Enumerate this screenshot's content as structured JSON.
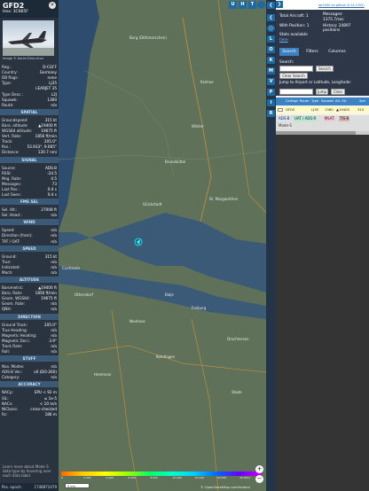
{
  "aircraft": {
    "callsign": "GFD2",
    "hex_line": "Hex: 3C665F",
    "photo_credit": "Image © Aaron Eden-Aruz"
  },
  "details": [
    {
      "k": "Reg.:",
      "v": "D-CGFF"
    },
    {
      "k": "Country:",
      "v": "Germany"
    },
    {
      "k": "DB flags:",
      "v": "none"
    },
    {
      "k": "Type:",
      "v": "LJ35"
    },
    {
      "k": "",
      "v": "LEARJET 35"
    },
    {
      "k": "Type Desc.:",
      "v": "L2J"
    },
    {
      "k": "Squawk:",
      "v": "1360"
    },
    {
      "k": "Route:",
      "v": "n/a"
    }
  ],
  "sections": {
    "spatial": {
      "title": "SPATIAL",
      "rows": [
        {
          "k": "Groundspeed:",
          "v": "315 kt"
        },
        {
          "k": "Baro. altitude:",
          "v": "▲19400 ft"
        },
        {
          "k": "WGS84 altitude:",
          "v": "19675 ft"
        },
        {
          "k": "Vert. Rate:",
          "v": "1856 ft/min"
        },
        {
          "k": "Track:",
          "v": "205.0°"
        },
        {
          "k": "Pos.:",
          "v": "53.933°, 9.065°"
        },
        {
          "k": "Distance:",
          "v": "120.7 nmi"
        }
      ]
    },
    "signal": {
      "title": "SIGNAL",
      "rows": [
        {
          "k": "Source:",
          "v": "ADS-B"
        },
        {
          "k": "RSSI:",
          "v": "-24.5"
        },
        {
          "k": "Msg. Rate:",
          "v": "4.5"
        },
        {
          "k": "Messages:",
          "v": "73"
        },
        {
          "k": "Last Pos.:",
          "v": "0.4 s"
        },
        {
          "k": "Last Seen:",
          "v": "0.4 s"
        }
      ]
    },
    "fms": {
      "title": "FMS SEL",
      "rows": [
        {
          "k": "Sel. Alt.:",
          "v": "27008 ft"
        },
        {
          "k": "Sel. Head.:",
          "v": "n/a"
        }
      ]
    },
    "wind": {
      "title": "WIND",
      "rows": [
        {
          "k": "Speed:",
          "v": "n/a"
        },
        {
          "k": "Direction (from):",
          "v": "n/a"
        },
        {
          "k": "TAT / OAT:",
          "v": "n/a"
        }
      ]
    },
    "speed": {
      "title": "SPEED",
      "rows": [
        {
          "k": "Ground:",
          "v": "315 kt"
        },
        {
          "k": "True:",
          "v": "n/a"
        },
        {
          "k": "Indicated:",
          "v": "n/a"
        },
        {
          "k": "Mach:",
          "v": "n/a"
        }
      ]
    },
    "altitude": {
      "title": "ALTITUDE",
      "rows": [
        {
          "k": "Barometric:",
          "v": "▲19400 ft"
        },
        {
          "k": "Baro. Rate:",
          "v": "1856 ft/min"
        },
        {
          "k": "Geom. WGS84:",
          "v": "19675 ft"
        },
        {
          "k": "Geom. Rate:",
          "v": "n/a"
        },
        {
          "k": "QNH:",
          "v": "n/a"
        }
      ]
    },
    "direction": {
      "title": "DIRECTION",
      "rows": [
        {
          "k": "Ground Track:",
          "v": "205.0°"
        },
        {
          "k": "True Heading:",
          "v": "n/a"
        },
        {
          "k": "Magnetic Heading:",
          "v": "n/a"
        },
        {
          "k": "Magnetic Decl.:",
          "v": "3.9°"
        },
        {
          "k": "Track Rate:",
          "v": "n/a"
        },
        {
          "k": "Roll:",
          "v": "n/a"
        }
      ]
    },
    "stuff": {
      "title": "STUFF",
      "rows": [
        {
          "k": "Nav. Modes:",
          "v": "n/a"
        },
        {
          "k": "ADS-B Ver.:",
          "v": "v0 (DO-260)"
        },
        {
          "k": "Category:",
          "v": "n/a"
        }
      ]
    },
    "accuracy": {
      "title": "ACCURACY",
      "rows": [
        {
          "k": "NACp:",
          "v": "EPU < 92 m"
        },
        {
          "k": "SIL:",
          "v": "≤ 1e-5"
        },
        {
          "k": "NACv:",
          "v": "< 10 m/s"
        },
        {
          "k": "NICbaro:",
          "v": "cross-checked"
        },
        {
          "k": "Rc:",
          "v": "186 m"
        }
      ]
    }
  },
  "note": "Learn more about Mode S data type by hovering over each data label.",
  "epoch": {
    "label": "Pos. epoch:",
    "value": "1748872479"
  },
  "map": {
    "labels": [
      "Glückstadt",
      "Brunsbüttel",
      "Itzehoe",
      "Wilster",
      "St. Margarethen",
      "Burg (Dithmarschen)",
      "Otterndorf",
      "Cuxhaven",
      "Hemmoor",
      "Balje",
      "Freiburg",
      "Neuhaus",
      "Drochtersen",
      "Stade",
      "Kehdingen"
    ],
    "scale": "5 km",
    "attribution": "© OpenStreetMap contributors",
    "zoom_in": "+",
    "zoom_out": "−",
    "colorbar_ticks": [
      "0",
      "2 000",
      "4 000",
      "6 000",
      "8 000",
      "10 000",
      "20 000",
      "30 000",
      "40 000+"
    ]
  },
  "rail": {
    "top_buttons": [
      "U",
      "H",
      "T"
    ],
    "buttons": [
      "L",
      "O",
      "K",
      "M",
      "V",
      "P",
      "I",
      "R"
    ]
  },
  "right": {
    "version_link": "tar1090 on github (3.14.1702)",
    "stats": {
      "total_label": "Total Aircraft:",
      "total_value": "1",
      "with_pos_label": "With Position:",
      "with_pos_value": "1",
      "stats_label": "Stats available",
      "stats_link": "here",
      "messages_label": "Messages:",
      "messages_value": "1375.7/sec",
      "history_label": "History:",
      "history_value": "24897 positions"
    },
    "tabs": [
      "Search",
      "Filters",
      "Columns"
    ],
    "search_label": "Search:",
    "search_button": "Search",
    "clear_button": "Clear Search",
    "jump_label": "Jump to Airport or Latitude, Longitude:",
    "jump_button": "Jump",
    "jump_clear": "Clear",
    "table_headers": [
      "",
      "Callsign",
      "Route",
      "Type",
      "Squawk",
      "Alt. (ft)",
      "Spd"
    ],
    "table_row": [
      "",
      "GFD2",
      "",
      "LJ35",
      "1360",
      "▲19400",
      "315"
    ],
    "legend": [
      "ADS-B",
      "UAT / ADS-R",
      "MLAT",
      "TIS-B",
      "Mode-S"
    ],
    "colors": {
      "adsb": "#d6e5f5",
      "uat": "#b7e9d0",
      "mlat": "#f3c4d0",
      "tisb": "#d9b2ad",
      "modes": "#e0e0e0"
    }
  }
}
